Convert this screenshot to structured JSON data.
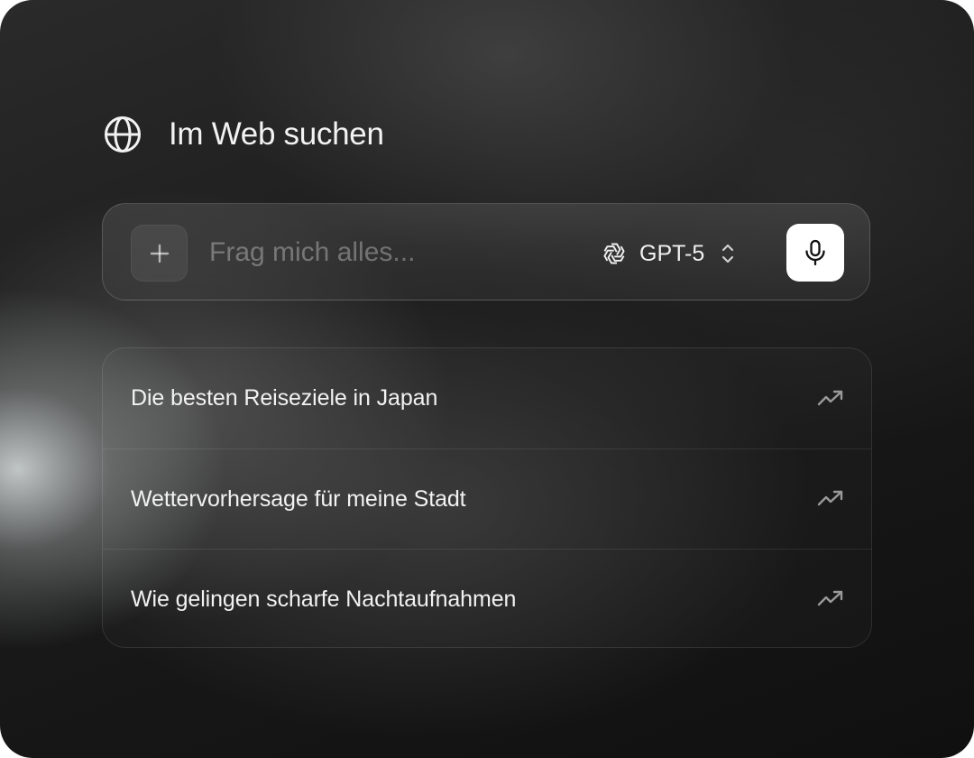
{
  "header": {
    "icon": "globe-icon",
    "title": "Im Web suchen"
  },
  "search": {
    "add_icon": "plus-icon",
    "placeholder": "Frag mich alles...",
    "value": "",
    "model": {
      "icon": "openai-logo-icon",
      "label": "GPT-5",
      "chevron_icon": "chevron-up-down-icon"
    },
    "mic_icon": "microphone-icon"
  },
  "suggestions": [
    {
      "text": "Die besten Reiseziele in Japan",
      "icon": "trending-up-icon"
    },
    {
      "text": "Wettervorhersage für meine Stadt",
      "icon": "trending-up-icon"
    },
    {
      "text": "Wie gelingen scharfe Nachtaufnahmen",
      "icon": "trending-up-icon"
    }
  ],
  "colors": {
    "background": "#1b1b1b",
    "text": "#f2f2f2",
    "mic_button": "#ffffff"
  }
}
